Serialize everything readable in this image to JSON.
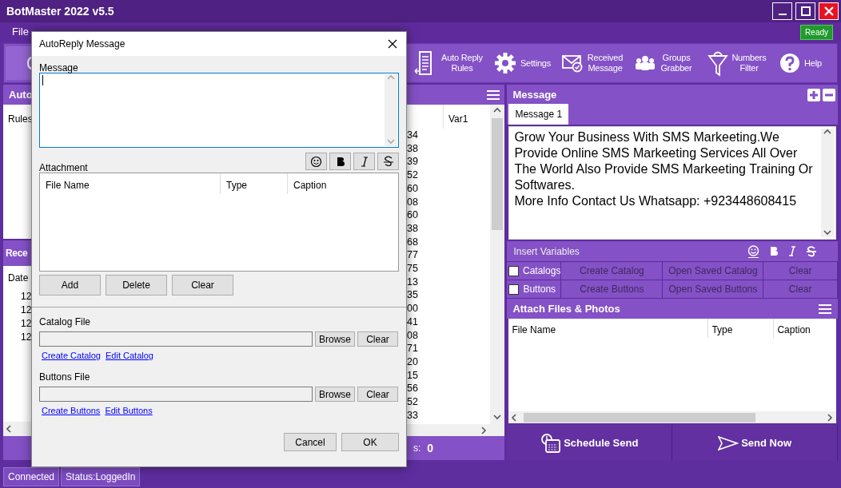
{
  "window": {
    "title": "BotMaster 2022 v5.5"
  },
  "menu": [
    "File"
  ],
  "status_badge": "Ready",
  "toolbar": [
    {
      "label": "Auto Reply Rules"
    },
    {
      "label": "Settings"
    },
    {
      "label": "Received Message"
    },
    {
      "label": "Groups Grabber"
    },
    {
      "label": "Numbers Filter"
    },
    {
      "label": "Help"
    }
  ],
  "rules_panel": {
    "title": "Auto",
    "column": "Rules"
  },
  "received_panel": {
    "title": "Rece",
    "column": "Date",
    "rows": [
      "12",
      "12",
      "12",
      "12"
    ]
  },
  "numbers_list": {
    "column": "Var1",
    "rows": [
      "34",
      "38",
      "39",
      "52",
      "60",
      "08",
      "60",
      "38",
      "68",
      "77",
      "75",
      "13",
      "35",
      "00",
      "41",
      "08",
      "71",
      "20",
      "15",
      "56",
      "52",
      "33"
    ]
  },
  "count_bar": {
    "label": "s:",
    "value": "0"
  },
  "message_panel": {
    "title": "Message",
    "tabs": [
      {
        "label": "Message 1",
        "selected": true
      }
    ],
    "text": "Grow Your Business With SMS Markeeting.We Provide Online SMS Markeeting Services All Over The World Also Provide SMS Markeeting Training Or Softwares.\nMore Info Contact Us Whatsapp: +923448608415",
    "insert_variables": "Insert Variables",
    "options": [
      {
        "label": "Catalogs",
        "checked": false,
        "create": "Create Catalog",
        "open": "Open Saved Catalog",
        "clear": "Clear"
      },
      {
        "label": "Buttons",
        "checked": false,
        "create": "Create Buttons",
        "open": "Open Saved Buttons",
        "clear": "Clear"
      }
    ]
  },
  "attach_panel": {
    "title": "Attach Files & Photos",
    "columns": [
      "File Name",
      "Type",
      "Caption"
    ]
  },
  "actions": [
    "Schedule Send",
    "Send Now"
  ],
  "status_bar": [
    "Connected",
    "Status:LoggedIn"
  ],
  "dialog": {
    "title": "AutoReply Message",
    "message_label": "Message",
    "attachment_label": "Attachment",
    "columns": [
      "File Name",
      "Type",
      "Caption"
    ],
    "list_buttons": [
      "Add",
      "Delete",
      "Clear"
    ],
    "catalog": {
      "label": "Catalog File",
      "browse": "Browse",
      "clear": "Clear",
      "links": [
        "Create Catalog",
        "Edit Catalog"
      ]
    },
    "buttons_file": {
      "label": "Buttons File",
      "browse": "Browse",
      "clear": "Clear",
      "links": [
        "Create Buttons",
        "Edit Buttons"
      ]
    },
    "footer": [
      "Cancel",
      "OK"
    ]
  }
}
